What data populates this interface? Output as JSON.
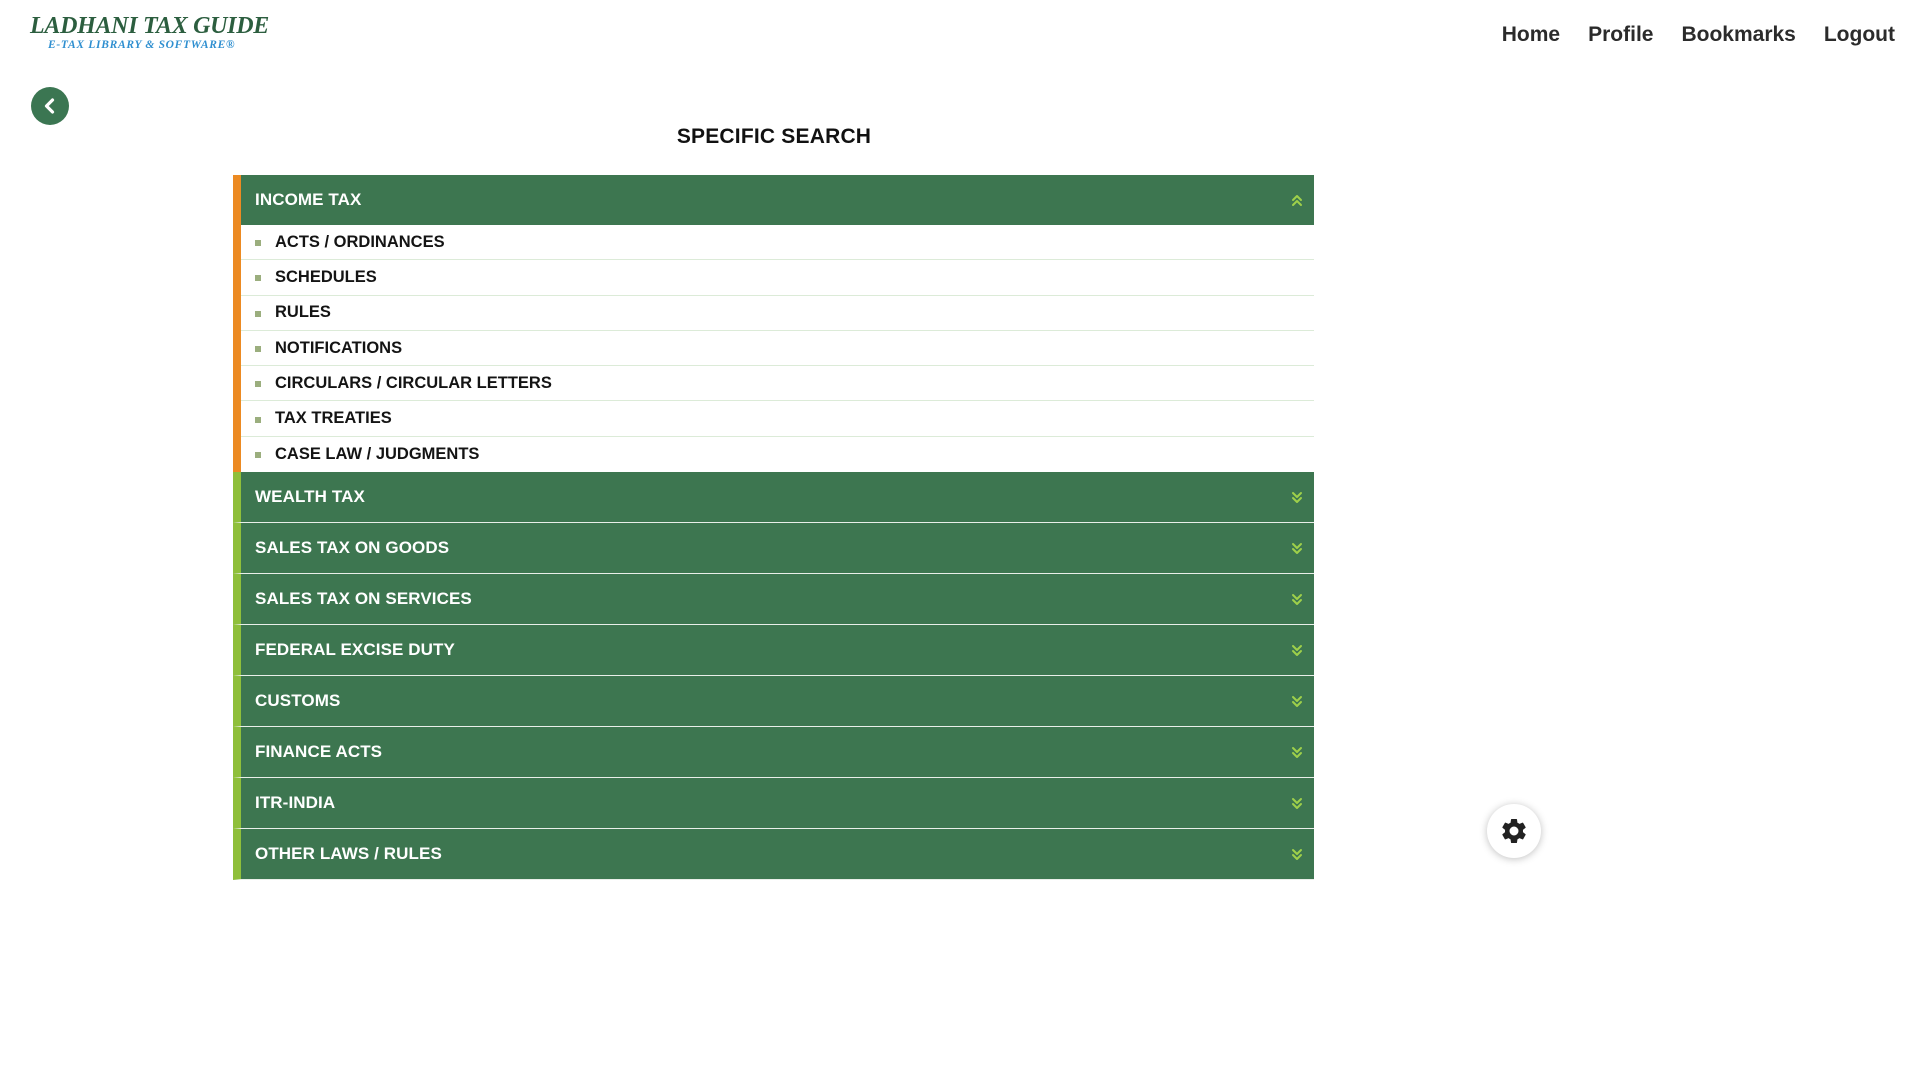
{
  "logo": {
    "title": "LADHANI TAX GUIDE",
    "subtitle": "E-TAX LIBRARY & SOFTWARE®"
  },
  "nav": [
    {
      "label": "Home"
    },
    {
      "label": "Profile"
    },
    {
      "label": "Bookmarks"
    },
    {
      "label": "Logout"
    }
  ],
  "page_title": "SPECIFIC SEARCH",
  "colors": {
    "header_green": "#3d7650",
    "open_accent": "#ec8a22",
    "closed_accent": "#8fbf3a",
    "chevron": "#9fd04a"
  },
  "sections": [
    {
      "title": "INCOME TAX",
      "expanded": true,
      "items": [
        "ACTS / ORDINANCES",
        "SCHEDULES",
        "RULES",
        "NOTIFICATIONS",
        "CIRCULARS / CIRCULAR LETTERS",
        "TAX TREATIES",
        "CASE LAW / JUDGMENTS"
      ]
    },
    {
      "title": "WEALTH TAX",
      "expanded": false,
      "items": []
    },
    {
      "title": "SALES TAX ON GOODS",
      "expanded": false,
      "items": []
    },
    {
      "title": "SALES TAX ON SERVICES",
      "expanded": false,
      "items": []
    },
    {
      "title": "FEDERAL EXCISE DUTY",
      "expanded": false,
      "items": []
    },
    {
      "title": "CUSTOMS",
      "expanded": false,
      "items": []
    },
    {
      "title": "FINANCE ACTS",
      "expanded": false,
      "items": []
    },
    {
      "title": "ITR-INDIA",
      "expanded": false,
      "items": []
    },
    {
      "title": "OTHER LAWS / RULES",
      "expanded": false,
      "items": []
    }
  ],
  "icons": {
    "back": "chevron-left-icon",
    "collapse": "double-chevron-up-icon",
    "expand": "double-chevron-down-icon",
    "settings": "gear-icon"
  }
}
